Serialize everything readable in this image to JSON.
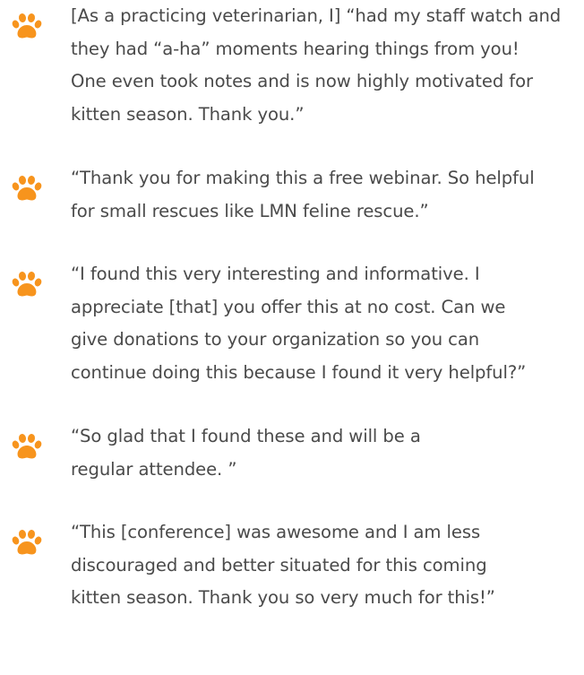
{
  "testimonials": [
    {
      "icon": "paw-print-icon",
      "lines": [
        "[As a practicing veterinarian, I] “had my staff watch and",
        "they had “a-ha” moments hearing things from you!",
        "One even took notes and is now highly motivated for",
        "kitten season. Thank you.”"
      ]
    },
    {
      "icon": "paw-print-icon",
      "lines": [
        "“Thank you for making this a free webinar. So helpful",
        "for small rescues like LMN feline rescue.”"
      ]
    },
    {
      "icon": "paw-print-icon",
      "lines": [
        "“I found this very interesting and informative. I",
        "appreciate [that] you offer this at no cost. Can we",
        "give donations to your organization so you can",
        "continue doing this because I found it very helpful?”"
      ]
    },
    {
      "icon": "paw-print-icon",
      "lines": [
        "“So glad that I found these and will be a",
        "regular attendee. ”"
      ]
    },
    {
      "icon": "paw-print-icon",
      "lines": [
        "“This [conference] was awesome and I am less",
        "discouraged and better situated for this coming",
        "kitten season. Thank you so very much for this!”"
      ]
    }
  ],
  "colors": {
    "paw": "#f7941d",
    "text": "#4a4a4a"
  }
}
